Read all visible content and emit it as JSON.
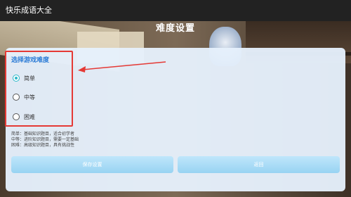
{
  "app": {
    "title": "快乐成语大全"
  },
  "page": {
    "title": "难度设置"
  },
  "difficulty": {
    "section_title": "选择游戏难度",
    "options": [
      {
        "label": "简单",
        "checked": true
      },
      {
        "label": "中等",
        "checked": false
      },
      {
        "label": "困难",
        "checked": false
      }
    ],
    "descriptions": [
      "简单：基础知识题目，适合初学者",
      "中等：进阶知识题目，需要一定基础",
      "困难：高级知识题目，具有挑战性"
    ]
  },
  "buttons": {
    "save": "保存设置",
    "back": "返回"
  },
  "colors": {
    "accent": "#2bb8c9",
    "annotation": "#e53935",
    "section_title": "#2b7bd6"
  }
}
